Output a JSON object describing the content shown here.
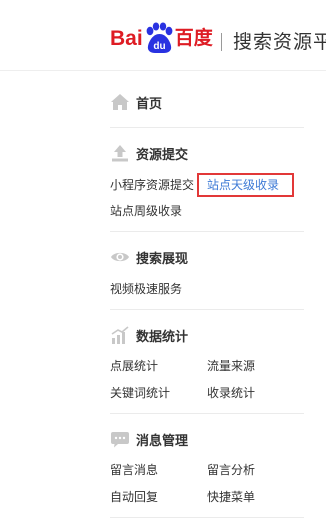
{
  "header": {
    "logo_text_left": "Bai",
    "logo_paw_text": "du",
    "logo_text_right": "百度",
    "title": "搜索资源平"
  },
  "colors": {
    "brand_red": "#de1c24",
    "paw_blue": "#2932e1",
    "active_link": "#3d7ad6",
    "highlight_border": "#e23838",
    "icon_gray": "#c8c8c8"
  },
  "sidebar": {
    "home": {
      "label": "首页",
      "icon": "house-icon"
    },
    "resource_submit": {
      "title": "资源提交",
      "icon": "upload-icon",
      "items": [
        "小程序资源提交",
        "站点天级收录",
        "站点周级收录"
      ]
    },
    "search_display": {
      "title": "搜索展现",
      "icon": "eye-icon",
      "items": [
        "视频极速服务"
      ]
    },
    "data_stats": {
      "title": "数据统计",
      "icon": "bar-chart-icon",
      "items": [
        "点展统计",
        "流量来源",
        "关键词统计",
        "收录统计"
      ]
    },
    "message_mgmt": {
      "title": "消息管理",
      "icon": "chat-bubble-icon",
      "items": [
        "留言消息",
        "留言分析",
        "自动回复",
        "快捷菜单"
      ]
    }
  }
}
